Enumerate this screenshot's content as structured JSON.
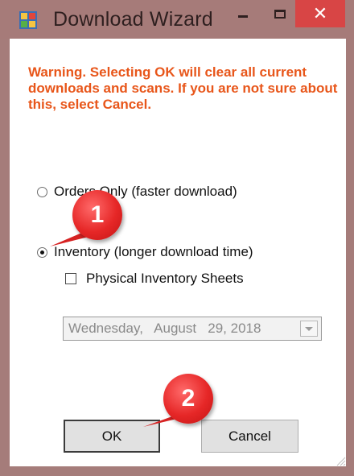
{
  "window": {
    "title": "Download Wizard",
    "close_glyph": "✕",
    "icon": "app-grid-icon"
  },
  "warning_text": "Warning. Selecting OK will clear all current downloads and scans. If you are not sure about this, select Cancel.",
  "options": {
    "orders_only": {
      "label": "Orders Only (faster download)",
      "selected": false
    },
    "inventory": {
      "label": "Inventory (longer download time)",
      "selected": true
    }
  },
  "physical_sheets": {
    "label": "Physical Inventory Sheets",
    "checked": false
  },
  "date_picker": {
    "value": "Wednesday,   August   29, 2018",
    "enabled": false
  },
  "buttons": {
    "ok": "OK",
    "cancel": "Cancel"
  },
  "callouts": {
    "first": "1",
    "second": "2"
  },
  "colors": {
    "warning": "#e8561a",
    "title_bar": "#a67b79",
    "close": "#d84545",
    "callout": "#e62727"
  }
}
